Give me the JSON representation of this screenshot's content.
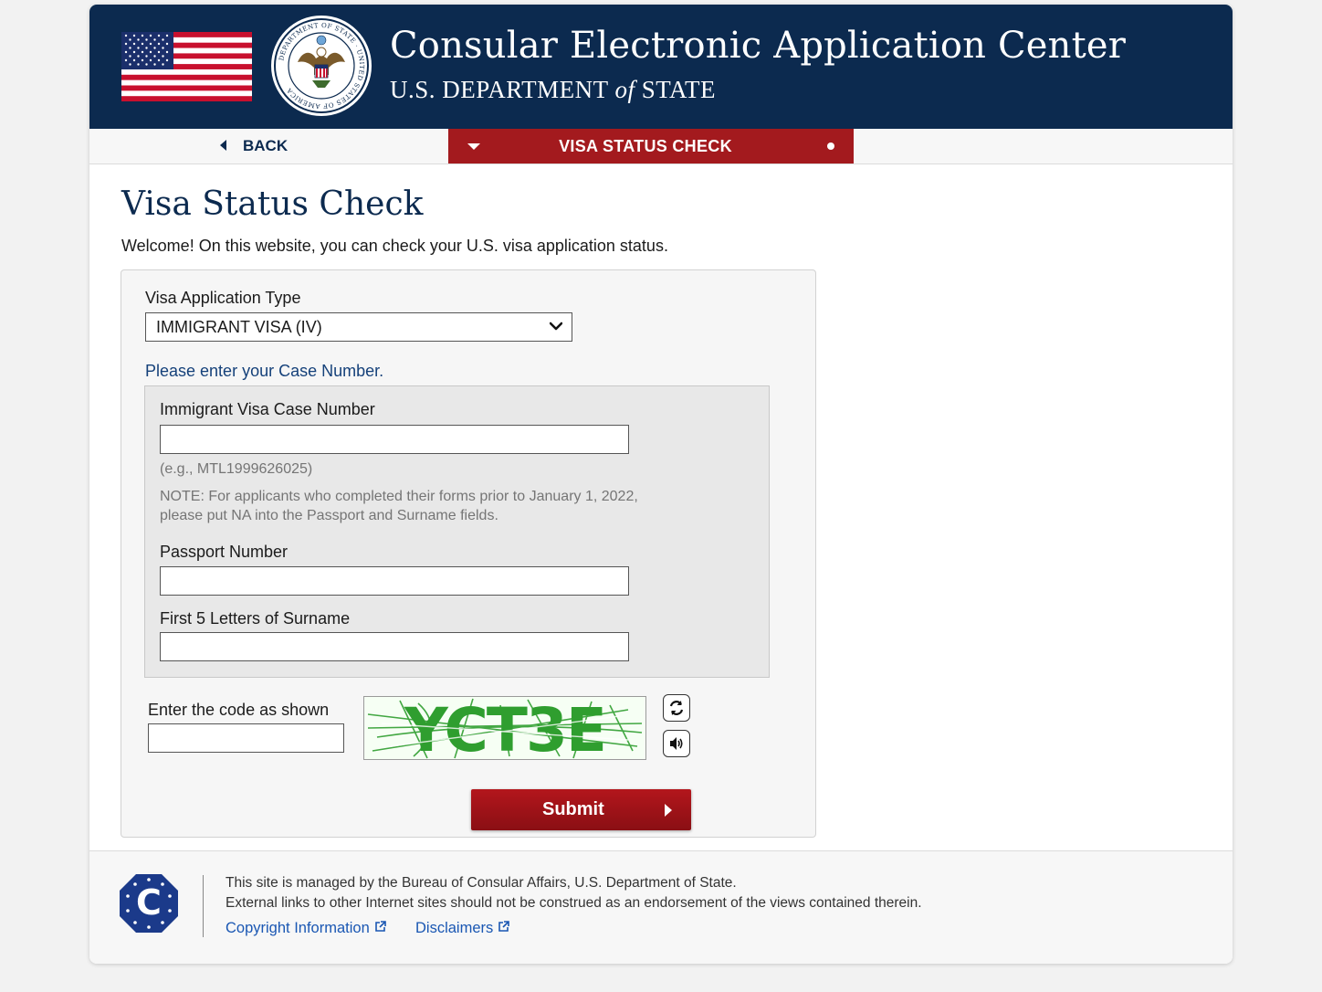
{
  "header": {
    "site_title": "Consular Electronic Application Center",
    "dept_prefix": "U.S. DEPARTMENT",
    "dept_of": "of",
    "dept_suffix": "STATE",
    "seal_text": "DEPARTMENT OF STATE · UNITED STATES OF AMERICA"
  },
  "nav": {
    "back_label": "BACK",
    "active_label": "VISA STATUS CHECK"
  },
  "main": {
    "title": "Visa Status Check",
    "welcome": "Welcome! On this website, you can check your U.S. visa application status."
  },
  "form": {
    "type_label": "Visa Application Type",
    "type_selected": "IMMIGRANT VISA (IV)",
    "case_prompt": "Please enter your Case Number.",
    "case_label": "Immigrant Visa Case Number",
    "case_value": "",
    "case_example": "(e.g., MTL1999626025)",
    "note_line1": "NOTE: For applicants who completed their forms prior to January 1, 2022,",
    "note_line2": "please put NA into the Passport and Surname fields.",
    "passport_label": "Passport Number",
    "passport_value": "",
    "surname_label": "First 5 Letters of Surname",
    "surname_value": "",
    "captcha_label": "Enter the code as shown",
    "captcha_value": "",
    "captcha_code": "YCT3E",
    "submit_label": "Submit"
  },
  "footer": {
    "logo_letter": "C",
    "line1": "This site is managed by the Bureau of Consular Affairs, U.S. Department of State.",
    "line2": "External links to other Internet sites should not be construed as an endorsement of the views contained therein.",
    "link_copyright": "Copyright Information",
    "link_disclaimers": "Disclaimers"
  },
  "colors": {
    "navy": "#0c2a4f",
    "red": "#a31a1e",
    "link_blue": "#1a57b3",
    "captcha_green": "#2f9e2f"
  }
}
